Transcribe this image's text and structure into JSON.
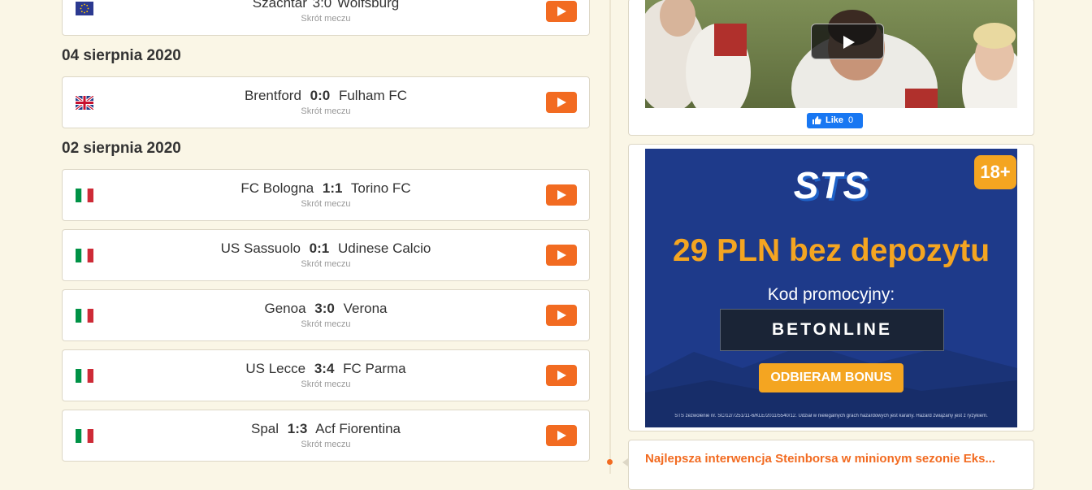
{
  "matches_top": {
    "home": "Szachtar",
    "score": "3:0",
    "away": "Wolfsburg",
    "subtitle": "Skrót meczu",
    "flag": "eu-flag-icon"
  },
  "sections": [
    {
      "date": "04 sierpnia 2020",
      "matches": [
        {
          "home": "Brentford",
          "score": "0:0",
          "away": "Fulham FC",
          "subtitle": "Skrót meczu",
          "flag": "uk-flag-icon"
        }
      ]
    },
    {
      "date": "02 sierpnia 2020",
      "matches": [
        {
          "home": "FC Bologna",
          "score": "1:1",
          "away": "Torino FC",
          "subtitle": "Skrót meczu",
          "flag": "italy-flag-icon"
        },
        {
          "home": "US Sassuolo",
          "score": "0:1",
          "away": "Udinese Calcio",
          "subtitle": "Skrót meczu",
          "flag": "italy-flag-icon"
        },
        {
          "home": "Genoa",
          "score": "3:0",
          "away": "Verona",
          "subtitle": "Skrót meczu",
          "flag": "italy-flag-icon"
        },
        {
          "home": "US Lecce",
          "score": "3:4",
          "away": "FC Parma",
          "subtitle": "Skrót meczu",
          "flag": "italy-flag-icon"
        },
        {
          "home": "Spal",
          "score": "1:3",
          "away": "Acf Fiorentina",
          "subtitle": "Skrót meczu",
          "flag": "italy-flag-icon"
        }
      ]
    }
  ],
  "video_panel": {
    "like_label": "Like",
    "like_count": "0"
  },
  "ad": {
    "logo": "STS",
    "age_badge": "18+",
    "headline": "29 PLN bez depozytu",
    "promo_label": "Kod promocyjny:",
    "promo_code": "BETONLINE",
    "cta": "ODBIERAM BONUS",
    "disclaimer": "STS zezwolenie nr. SC/12/7251/11-6/KLE/2011/5540/12. Udział w nielegalnych grach hazardowych jest karany. Hazard związany jest z ryzykiem.",
    "colors": {
      "background": "#1e3a8a",
      "accent": "#f4a521"
    }
  },
  "news": {
    "title": "Najlepsza interwencja Steinborsa w minionym sezonie Eks..."
  },
  "colors": {
    "page_bg": "#faf6e6",
    "play_button": "#f26b21",
    "facebook": "#1877f2"
  }
}
